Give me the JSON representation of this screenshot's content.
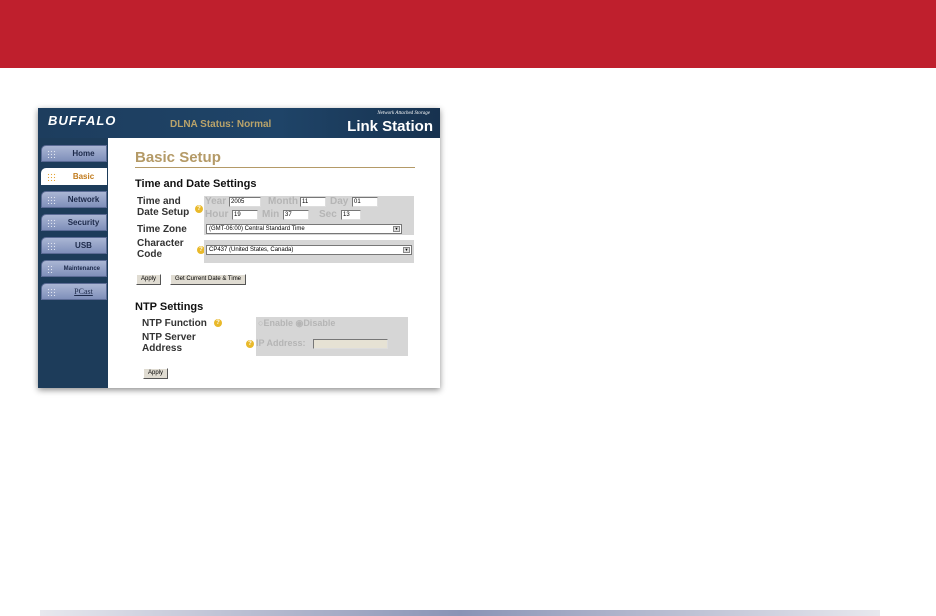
{
  "header": {
    "logo": "BUFFALO",
    "dlna_status": "DLNA Status: Normal",
    "tagline": "Network Attached Storage",
    "product": "Link Station"
  },
  "sidebar": {
    "items": [
      {
        "label": "Home"
      },
      {
        "label": "Basic",
        "active": true
      },
      {
        "label": "Network"
      },
      {
        "label": "Security"
      },
      {
        "label": "USB"
      },
      {
        "label": "Maintenance"
      },
      {
        "label": "PCast"
      }
    ]
  },
  "page": {
    "title": "Basic Setup"
  },
  "time_date": {
    "heading": "Time and Date Settings",
    "setup_label": "Time and Date Setup",
    "year_label": "Year",
    "year": "2005",
    "month_label": "Month",
    "month": "11",
    "day_label": "Day",
    "day": "01",
    "hour_label": "Hour",
    "hour": "19",
    "min_label": "Min",
    "min": "37",
    "sec_label": "Sec",
    "sec": "13",
    "timezone_label": "Time Zone",
    "timezone": "(GMT-06:00) Central Standard Time",
    "charcode_label": "Character Code",
    "charcode": "CP437 (United States, Canada)",
    "apply": "Apply",
    "get_current": "Get Current Date & Time"
  },
  "ntp": {
    "heading": "NTP Settings",
    "function_label": "NTP Function",
    "enable": "Enable",
    "disable": "Disable",
    "selected": "Disable",
    "server_label": "NTP Server Address",
    "ip_label": "IP Address:",
    "ip": "",
    "apply": "Apply"
  },
  "icons": {
    "help": "?",
    "dropdown": "▼"
  }
}
